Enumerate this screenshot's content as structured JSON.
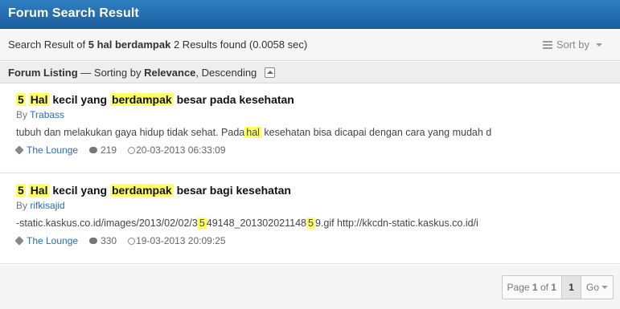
{
  "header": {
    "title": "Forum Search Result"
  },
  "summary": {
    "prefix": "Search Result of",
    "query": "5 hal berdampak",
    "results": "2 Results found (0.0058 sec)",
    "sort_label": "Sort by"
  },
  "listing": {
    "title": "Forum Listing",
    "sorting_prefix": "— Sorting by",
    "sort_field": "Relevance",
    "sort_order": ", Descending"
  },
  "results": [
    {
      "title": {
        "w1": "5",
        "w2": "Hal",
        "w3": "kecil yang",
        "w4": "berdampak",
        "w5": "besar pada kesehatan"
      },
      "by": "By",
      "author": "Trabass",
      "snippet": {
        "a": "tubuh dan melakukan gaya hidup tidak sehat. Pada",
        "b": "hal",
        "c": " kesehatan bisa dicapai dengan cara yang mudah d"
      },
      "forum": "The Lounge",
      "replies": "219",
      "date": "20-03-2013 06:33:09"
    },
    {
      "title": {
        "w1": "5",
        "w2": "Hal",
        "w3": "kecil yang",
        "w4": "berdampak",
        "w5": "besar bagi kesehatan"
      },
      "by": "By",
      "author": "rifkisajid",
      "snippet": {
        "a": "-static.kaskus.co.id/images/2013/02/02/3",
        "b": "5",
        "c": "49148_201302021148",
        "d": "5",
        "e": "9.gif http://kkcdn-static.kaskus.co.id/i"
      },
      "forum": "The Lounge",
      "replies": "330",
      "date": "19-03-2013 20:09:25"
    }
  ],
  "pagination": {
    "page_label": "Page",
    "current": "1",
    "of_label": "of",
    "total": "1",
    "active_page": "1",
    "go_label": "Go"
  }
}
